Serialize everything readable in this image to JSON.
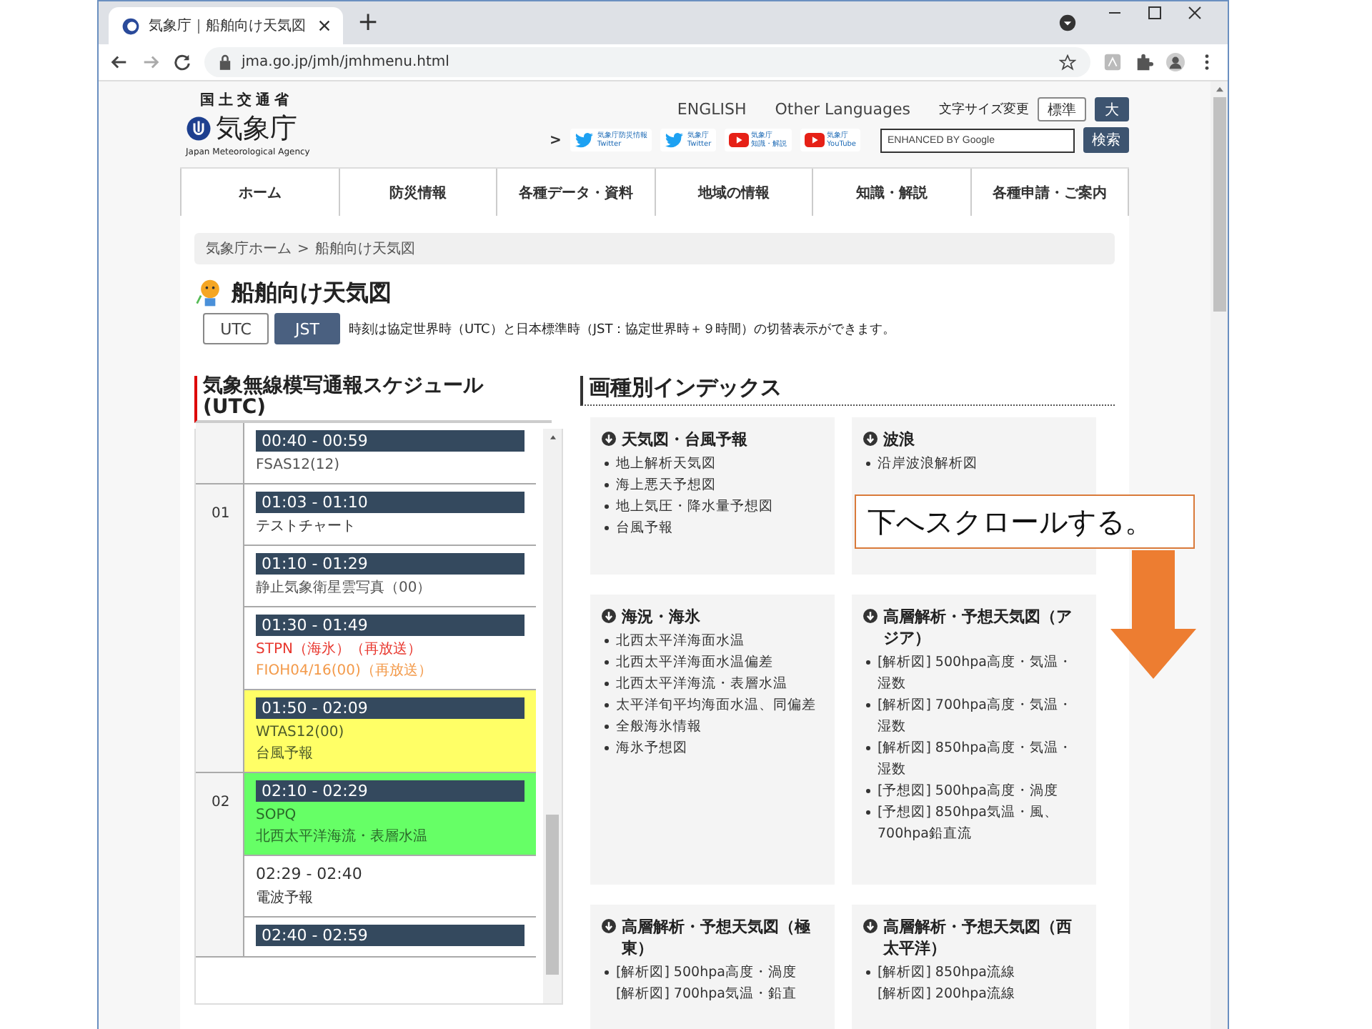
{
  "browser": {
    "tab_title": "気象庁｜船舶向け天気図",
    "new_tab": "+",
    "url": "jma.go.jp/jmh/jmhmenu.html"
  },
  "header": {
    "ministry": "国土交通省",
    "agency": "気象庁",
    "agency_en": "Japan Meteorological Agency",
    "lang_links": [
      "ENGLISH",
      "Other Languages"
    ],
    "more_mark": ">",
    "font_size_label": "文字サイズ変更",
    "font_sizes": [
      {
        "label": "標準",
        "selected": false
      },
      {
        "label": "大",
        "selected": true
      }
    ],
    "social": [
      {
        "kind": "twitter",
        "line1": "気象庁防災情報",
        "line2": "Twitter"
      },
      {
        "kind": "twitter",
        "line1": "気象庁",
        "line2": "Twitter"
      },
      {
        "kind": "youtube",
        "line1": "気象庁",
        "line2": "知識・解説"
      },
      {
        "kind": "youtube",
        "line1": "気象庁",
        "line2": "YouTube"
      }
    ],
    "search": {
      "placeholder": "ENHANCED BY Google",
      "button": "検索"
    }
  },
  "nav": [
    "ホーム",
    "防災情報",
    "各種データ・資料",
    "地域の情報",
    "知識・解説",
    "各種申請・ご案内"
  ],
  "breadcrumb": {
    "items": [
      "気象庁ホーム",
      "船舶向け天気図"
    ],
    "separator": ">"
  },
  "page_title": "船舶向け天気図",
  "time_toggle": [
    {
      "label": "UTC",
      "selected": false
    },
    {
      "label": "JST",
      "selected": true
    }
  ],
  "time_note": "時刻は協定世界時（UTC）と日本標準時（JST：協定世界時＋９時間）の切替表示ができます。",
  "schedule": {
    "title": "気象無線模写通報スケジュール(UTC)",
    "groups": [
      {
        "slots": [
          {
            "kind": "banner",
            "time": "00:40 - 00:59",
            "color": "#ffffff",
            "lines": [
              {
                "text": "FSAS12(12)",
                "color": "#555555"
              }
            ]
          }
        ]
      },
      {
        "hour": "01",
        "slots": [
          {
            "kind": "banner",
            "time": "01:03 - 01:10",
            "color": "#ffffff",
            "lines": [
              {
                "text": "テストチャート",
                "color": "#333333"
              }
            ]
          },
          {
            "kind": "banner",
            "time": "01:10 - 01:29",
            "color": "#ffffff",
            "lines": [
              {
                "text": "静止気象衛星雲写真（00）",
                "color": "#555555"
              }
            ]
          },
          {
            "kind": "banner",
            "time": "01:30 - 01:49",
            "color": "#ffffff",
            "lines": [
              {
                "text": "STPN（海氷）（再放送）",
                "color": "#e8382f"
              },
              {
                "text": "FIOH04/16(00)（再放送）",
                "color": "#f39a4a"
              }
            ]
          },
          {
            "kind": "banner",
            "time": "01:50 - 02:09",
            "color": "#ffff66",
            "lines": [
              {
                "text": "WTAS12(00)",
                "color": "#4d5b2a"
              },
              {
                "text": "台風予報",
                "color": "#4d5b2a"
              }
            ]
          }
        ]
      },
      {
        "hour": "02",
        "slots": [
          {
            "kind": "banner",
            "time": "02:10 - 02:29",
            "color": "#66ff66",
            "lines": [
              {
                "text": "SOPQ",
                "color": "#2a6a2a"
              },
              {
                "text": "北西太平洋海流・表層水温",
                "color": "#2a6a2a"
              }
            ]
          },
          {
            "kind": "plain",
            "time": "02:29 - 02:40",
            "color": "#ffffff",
            "lines": [
              {
                "text": "電波予報",
                "color": "#333333"
              }
            ]
          },
          {
            "kind": "banner",
            "time": "02:40 - 02:59",
            "color": "#ffffff"
          }
        ]
      }
    ]
  },
  "index": {
    "title": "画種別インデックス",
    "cards": [
      {
        "title": "天気図・台風予報",
        "items": [
          "地上解析天気図",
          "海上悪天予想図",
          "地上気圧・降水量予想図",
          "台風予報"
        ]
      },
      {
        "title": "波浪",
        "items": [
          "沿岸波浪解析図"
        ]
      },
      {
        "title": "海況・海氷",
        "items": [
          "北西太平洋海面水温",
          "北西太平洋海面水温偏差",
          "北西太平洋海流・表層水温",
          "太平洋旬平均海面水温、同偏差",
          "全般海氷情報",
          "海氷予想図"
        ]
      },
      {
        "title": "高層解析・予想天気図（アジア）",
        "items": [
          "[解析図] 500hpa高度・気温・湿数",
          "[解析図] 700hpa高度・気温・湿数",
          "[解析図] 850hpa高度・気温・湿数",
          "[予想図] 500hpa高度・渦度",
          "[予想図] 850hpa気温・風、700hpa鉛直流"
        ]
      },
      {
        "title": "高層解析・予想天気図（極東）",
        "items": [
          "[解析図] 500hpa高度・渦度\n[解析図] 700hpa気温・鉛直"
        ]
      },
      {
        "title": "高層解析・予想天気図（西太平洋）",
        "items": [
          "[解析図] 850hpa流線\n[解析図] 200hpa流線"
        ]
      }
    ]
  },
  "callout": "下へスクロールする。"
}
